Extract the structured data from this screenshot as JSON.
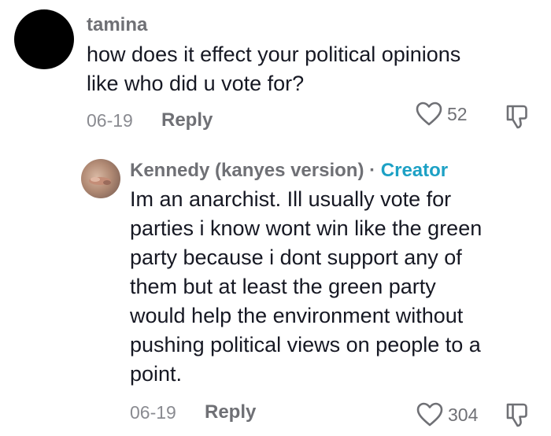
{
  "comment1": {
    "username": "tamina",
    "text": "how does it effect your political opinions\nlike who did u vote for?",
    "date": "06-19",
    "reply_label": "Reply",
    "likes": "52"
  },
  "comment2": {
    "username": "Kennedy (kanyes version)",
    "separator": " · ",
    "creator_label": "Creator",
    "text": "Im an anarchist. Ill usually vote for\nparties i know wont win like the green\nparty because i dont support any of\nthem but at least the green party\nwould help the environment without\npushing political views on people to a\npoint.",
    "date": "06-19",
    "reply_label": "Reply",
    "likes": "304"
  },
  "colors": {
    "creator": "#1da1c5",
    "muted": "#6f7075",
    "text": "#161823"
  },
  "icons": {
    "like": "heart-outline-icon",
    "dislike": "thumbs-down-outline-icon"
  }
}
